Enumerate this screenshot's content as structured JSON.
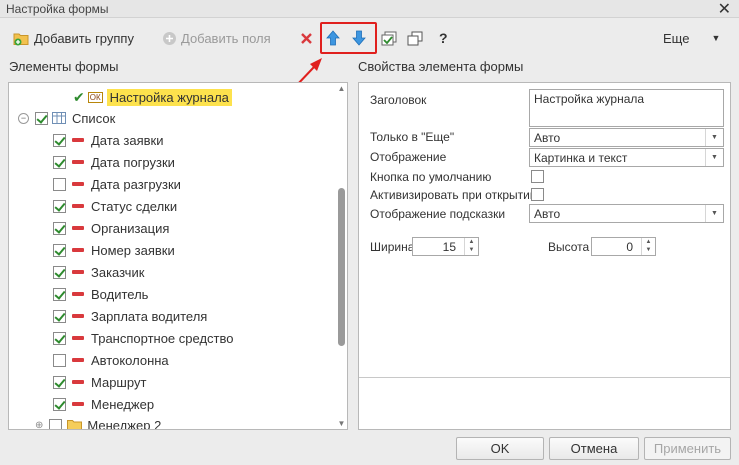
{
  "window": {
    "title": "Настройка формы",
    "close_glyph": "✕"
  },
  "toolbar": {
    "add_group_label": "Добавить группу",
    "add_fields_label": "Добавить поля",
    "delete_icon": "red-x-icon",
    "move_up_icon": "arrow-up-icon",
    "move_down_icon": "arrow-down-icon",
    "help_label": "?",
    "more_label": "Еще",
    "highlight_color": "#e0201e"
  },
  "tree": {
    "section_title": "Элементы формы",
    "journal_label": "Настройка журнала",
    "journal_badge": "ОК",
    "list_label": "Список",
    "items": [
      {
        "label": "Дата заявки",
        "checked": true
      },
      {
        "label": "Дата погрузки",
        "checked": true
      },
      {
        "label": "Дата разгрузки",
        "checked": false
      },
      {
        "label": "Статус сделки",
        "checked": true
      },
      {
        "label": "Организация",
        "checked": true
      },
      {
        "label": "Номер заявки",
        "checked": true
      },
      {
        "label": "Заказчик",
        "checked": true
      },
      {
        "label": "Водитель",
        "checked": true
      },
      {
        "label": "Зарплата водителя",
        "checked": true
      },
      {
        "label": "Транспортное средство",
        "checked": true
      },
      {
        "label": "Автоколонна",
        "checked": false
      },
      {
        "label": "Маршрут",
        "checked": true
      },
      {
        "label": "Менеджер",
        "checked": true
      }
    ],
    "last_group_label": "Менеджер 2"
  },
  "props": {
    "section_title": "Свойства элемента формы",
    "title_label": "Заголовок",
    "title_value": "Настройка журнала",
    "only_more_label": "Только в \"Еще\"",
    "only_more_value": "Авто",
    "display_label": "Отображение",
    "display_value": "Картинка и текст",
    "default_button_label": "Кнопка по умолчанию",
    "activate_label": "Активизировать при открытии",
    "tooltip_label": "Отображение подсказки",
    "tooltip_value": "Авто",
    "width_label": "Ширина",
    "width_value": "15",
    "height_label": "Высота",
    "height_value": "0"
  },
  "footer": {
    "ok_label": "OK",
    "cancel_label": "Отмена",
    "apply_label": "Применить"
  }
}
